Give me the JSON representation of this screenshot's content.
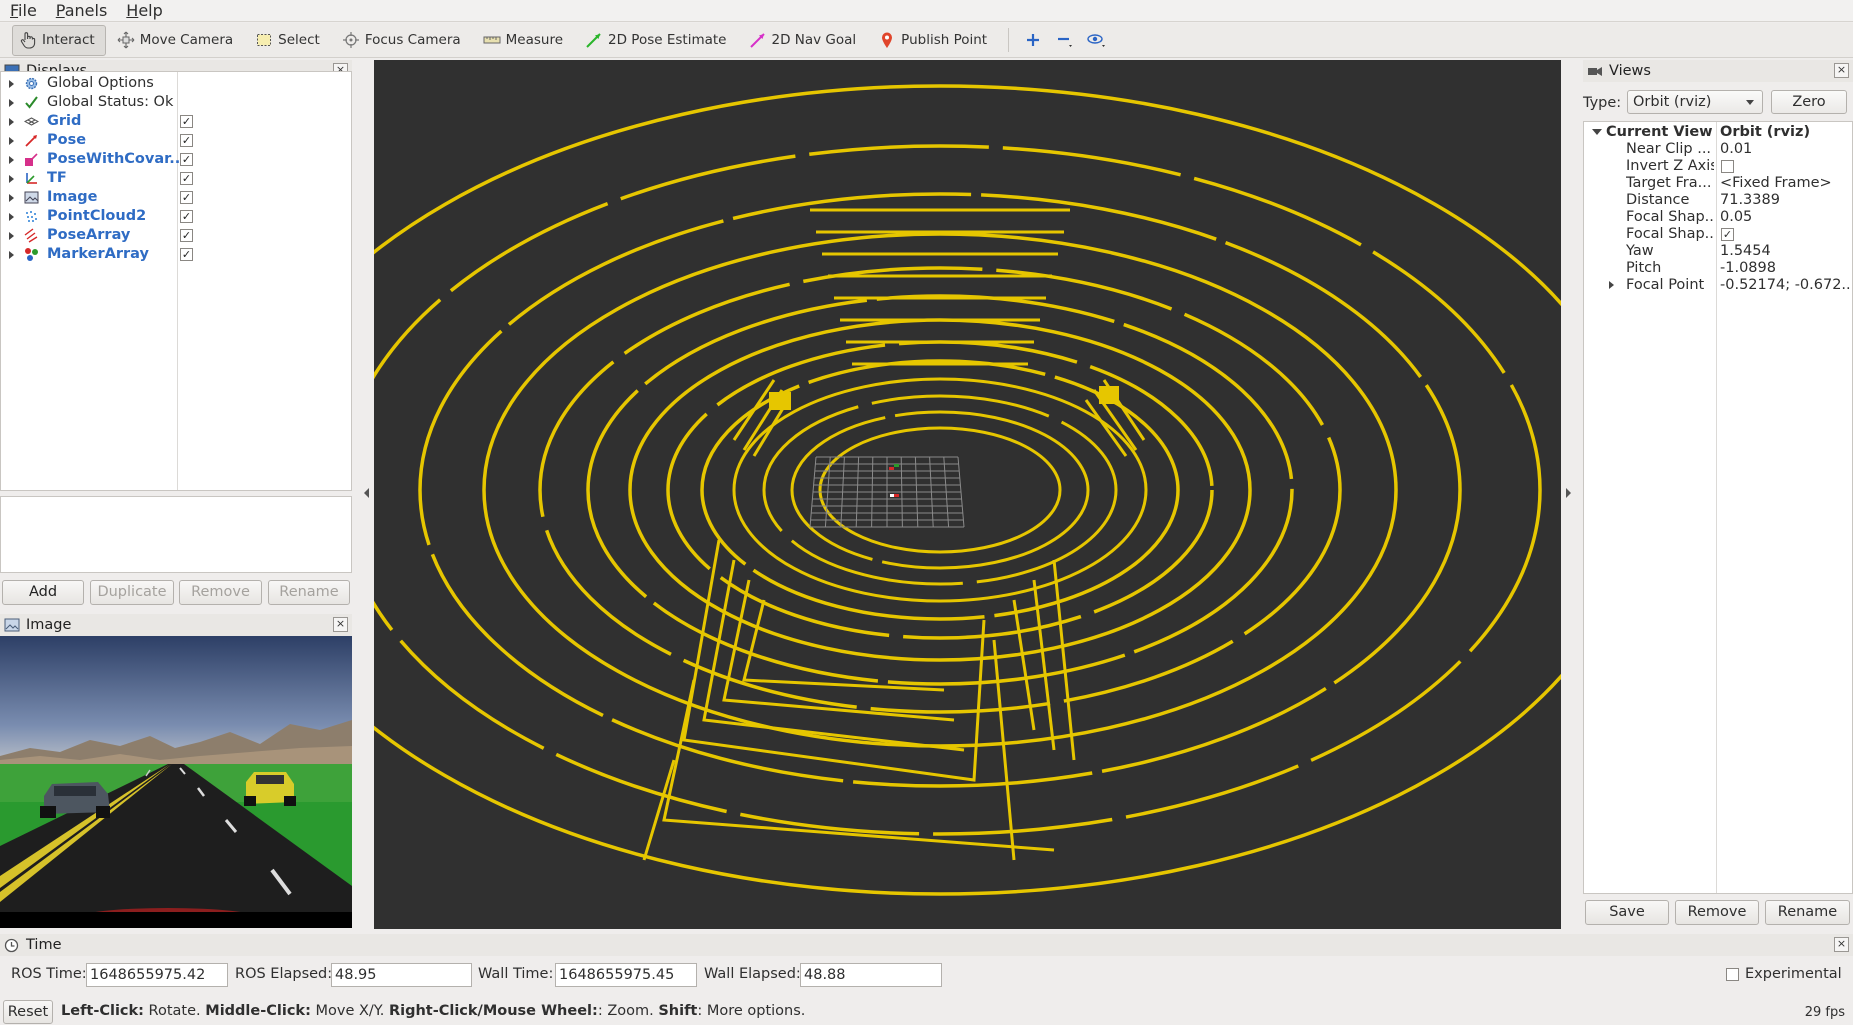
{
  "menu": [
    {
      "label": "File",
      "key": "F",
      "rest": "ile"
    },
    {
      "label": "Panels",
      "key": "P",
      "rest": "anels"
    },
    {
      "label": "Help",
      "key": "H",
      "rest": "elp"
    }
  ],
  "toolbar": {
    "interact": "Interact",
    "move_camera": "Move Camera",
    "select": "Select",
    "focus_camera": "Focus Camera",
    "measure": "Measure",
    "pose_estimate": "2D Pose Estimate",
    "nav_goal": "2D Nav Goal",
    "publish_point": "Publish Point"
  },
  "displays": {
    "title": "Displays",
    "items": [
      {
        "label": "Global Options",
        "icon": "gear-icon",
        "checked": null,
        "blue": false
      },
      {
        "label": "Global Status: Ok",
        "icon": "checkmark-icon",
        "checked": null,
        "blue": false
      },
      {
        "label": "Grid",
        "icon": "grid-icon",
        "checked": true,
        "blue": true
      },
      {
        "label": "Pose",
        "icon": "pose-arrow-icon",
        "checked": true,
        "blue": true
      },
      {
        "label": "PoseWithCovar...",
        "icon": "pose-covariance-icon",
        "checked": true,
        "blue": true
      },
      {
        "label": "TF",
        "icon": "tf-axes-icon",
        "checked": true,
        "blue": true
      },
      {
        "label": "Image",
        "icon": "image-icon",
        "checked": true,
        "blue": true
      },
      {
        "label": "PointCloud2",
        "icon": "pointcloud-icon",
        "checked": true,
        "blue": true
      },
      {
        "label": "PoseArray",
        "icon": "pose-array-icon",
        "checked": true,
        "blue": true
      },
      {
        "label": "MarkerArray",
        "icon": "marker-array-icon",
        "checked": true,
        "blue": true
      }
    ],
    "buttons": {
      "add": "Add",
      "duplicate": "Duplicate",
      "remove": "Remove",
      "rename": "Rename"
    }
  },
  "image_panel": {
    "title": "Image"
  },
  "views": {
    "title": "Views",
    "type_label": "Type:",
    "type_value": "Orbit (rviz)",
    "zero": "Zero",
    "current_view_label": "Current View",
    "current_view_value": "Orbit (rviz)",
    "props": [
      {
        "key": "Near Clip ...",
        "value": "0.01"
      },
      {
        "key": "Invert Z Axis",
        "value": "",
        "check": false
      },
      {
        "key": "Target Fra...",
        "value": "<Fixed Frame>"
      },
      {
        "key": "Distance",
        "value": "71.3389"
      },
      {
        "key": "Focal Shap...",
        "value": "0.05"
      },
      {
        "key": "Focal Shap...",
        "value": "",
        "check": true
      },
      {
        "key": "Yaw",
        "value": "1.5454"
      },
      {
        "key": "Pitch",
        "value": "-1.0898"
      },
      {
        "key": "Focal Point",
        "value": "-0.52174; -0.672...",
        "expandable": true
      }
    ],
    "buttons": {
      "save": "Save",
      "remove": "Remove",
      "rename": "Rename"
    }
  },
  "time": {
    "title": "Time",
    "ros_time_label": "ROS Time:",
    "ros_time": "1648655975.42",
    "ros_elapsed_label": "ROS Elapsed:",
    "ros_elapsed": "48.95",
    "wall_time_label": "Wall Time:",
    "wall_time": "1648655975.45",
    "wall_elapsed_label": "Wall Elapsed:",
    "wall_elapsed": "48.88",
    "experimental": "Experimental"
  },
  "status": {
    "reset": "Reset",
    "left_click": "Left-Click:",
    "left_click_desc": " Rotate. ",
    "middle_click": "Middle-Click:",
    "middle_click_desc": " Move X/Y. ",
    "right_click": "Right-Click/Mouse Wheel:",
    "right_click_desc": ": Zoom. ",
    "shift": "Shift",
    "shift_desc": ": More options.",
    "fps": "29 fps"
  },
  "colors": {
    "pointcloud": "#e6c600",
    "background_3d": "#303030",
    "display_label": "#2f6cc4"
  }
}
